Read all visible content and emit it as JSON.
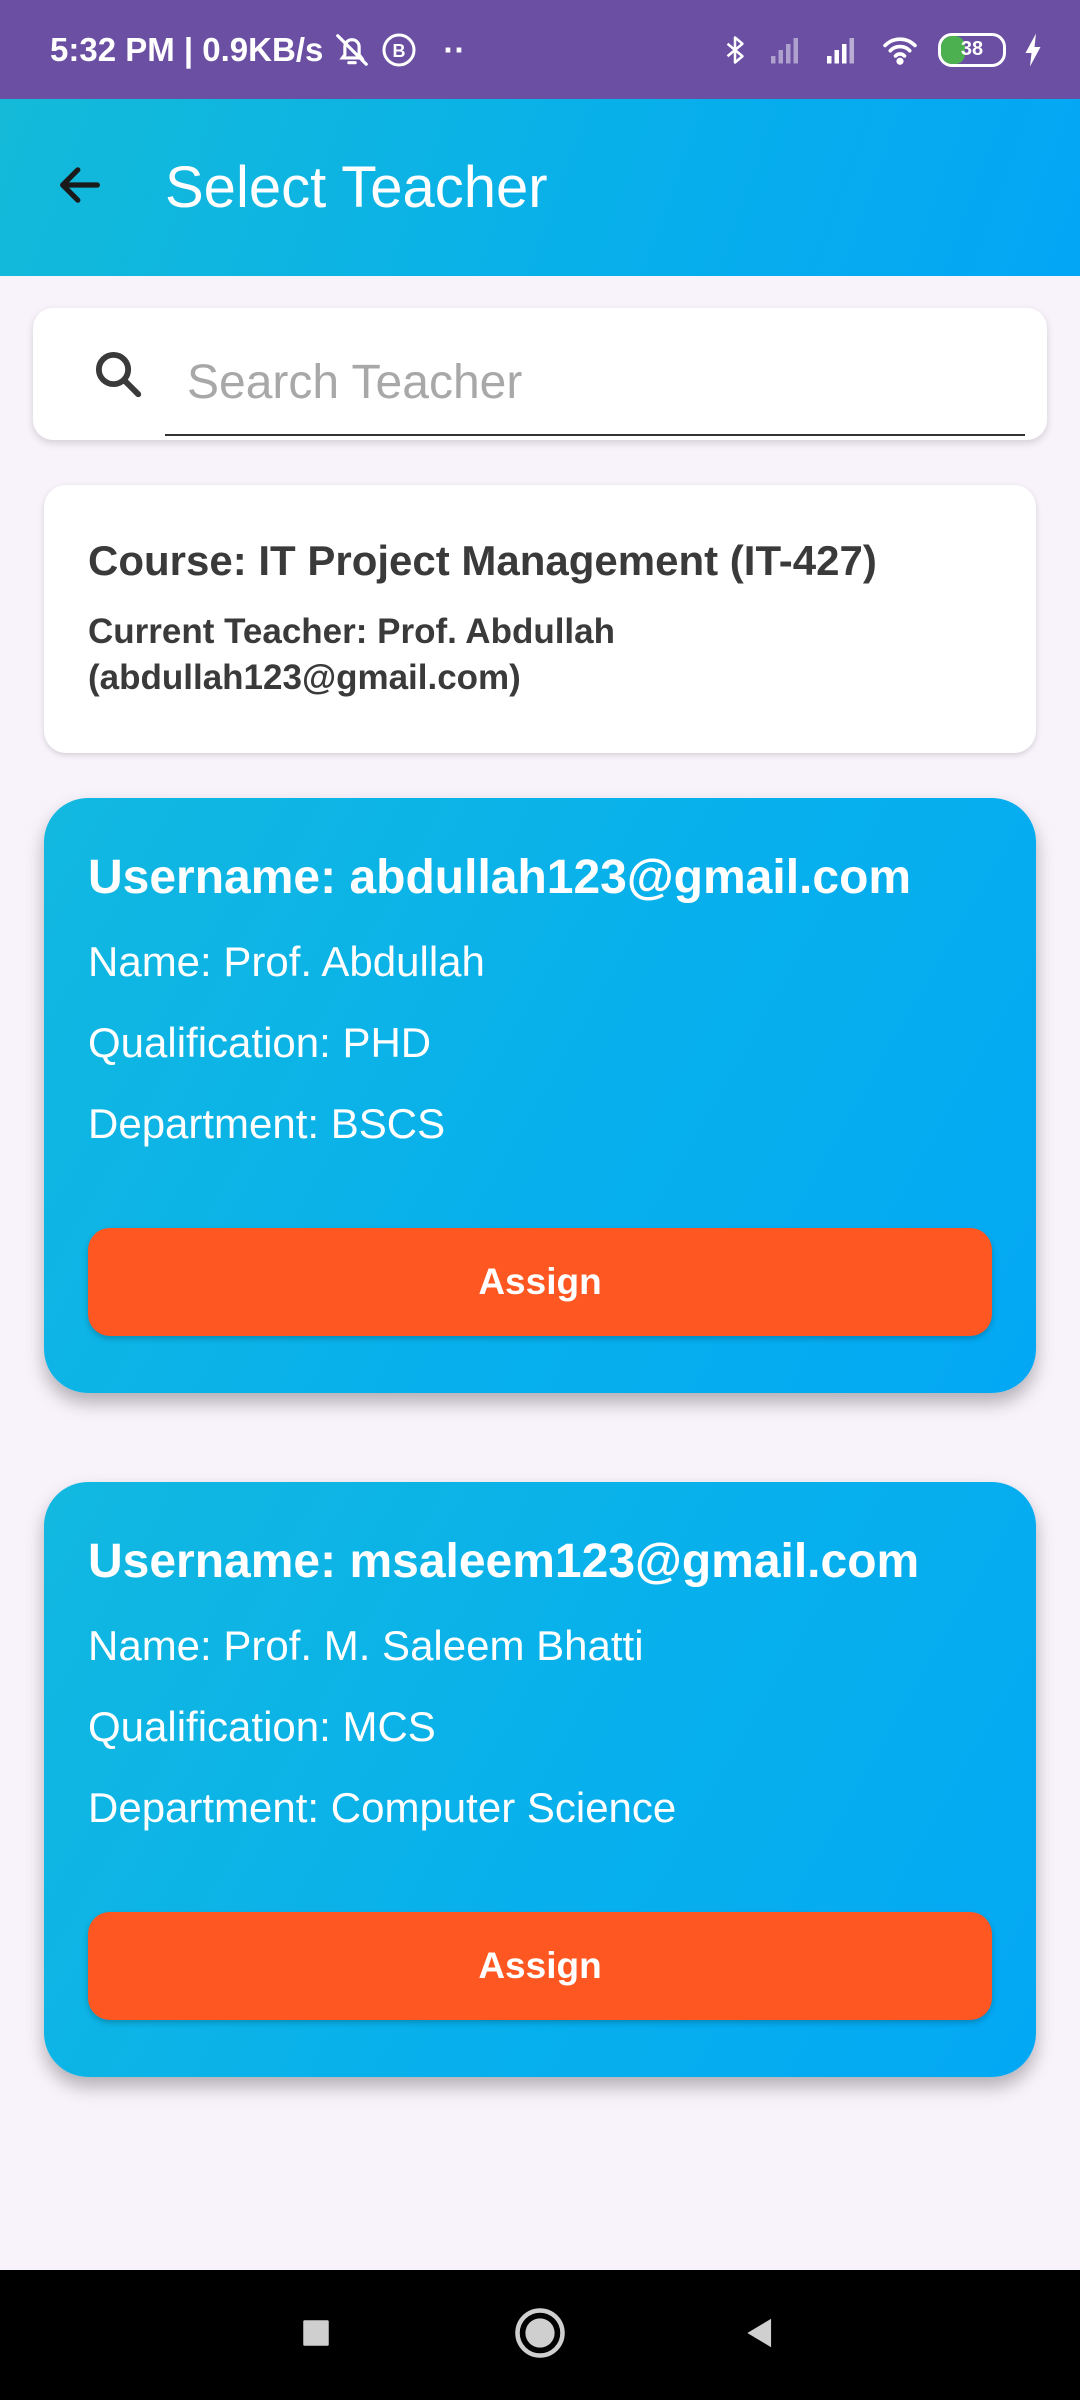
{
  "status_bar": {
    "time": "5:32 PM | 0.9KB/s",
    "extra": "··",
    "battery_level": "38",
    "battery_fraction": 0.38
  },
  "app_bar": {
    "title": "Select Teacher",
    "back_icon": "arrow-back-icon"
  },
  "search": {
    "placeholder": "Search Teacher",
    "value": "",
    "icon": "search-icon"
  },
  "course": {
    "title": "Course: IT Project Management (IT-427)",
    "current_teacher_line1": "Current Teacher: Prof. Abdullah",
    "current_teacher_line2": "(abdullah123@gmail.com)"
  },
  "teachers": [
    {
      "username": "Username: abdullah123@gmail.com",
      "name": "Name: Prof. Abdullah",
      "qualification": "Qualification: PHD",
      "department": "Department: BSCS",
      "assign_label": "Assign"
    },
    {
      "username": "Username: msaleem123@gmail.com",
      "name": "Name: Prof. M. Saleem Bhatti",
      "qualification": "Qualification: MCS",
      "department": "Department: Computer Science",
      "assign_label": "Assign"
    }
  ],
  "colors": {
    "status_bar": "#6a4fa3",
    "accent": "#03a9f4",
    "assign_button": "#ff5722",
    "background": "#f8f2fa"
  },
  "nav_bar": {
    "icons": [
      "recents-square-icon",
      "home-circle-icon",
      "back-triangle-icon"
    ]
  }
}
